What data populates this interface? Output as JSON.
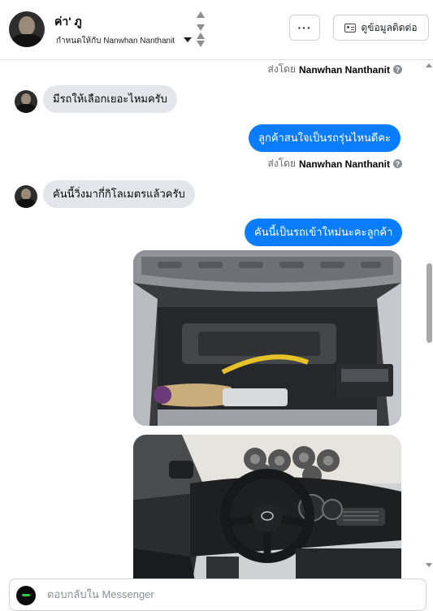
{
  "header": {
    "contact_name": "ค่า' ภู",
    "assigned_prefix": "กำหนดให้กับ",
    "assigned_name": "Nanwhan Nanthanit",
    "more_label": "···",
    "contact_info_label": "ดูข้อมูลติดต่อ"
  },
  "messages": [
    {
      "type": "sent_by",
      "prefix": "ส่งโดย",
      "name": "Nanwhan Nanthanit"
    },
    {
      "type": "incoming",
      "text": "มีรถให้เลือกเยอะไหมครับ"
    },
    {
      "type": "outgoing",
      "text": "ลูกค้าสนใจเป็นรถรุ่นไหนดีคะ"
    },
    {
      "type": "sent_by",
      "prefix": "ส่งโดย",
      "name": "Nanwhan Nanthanit"
    },
    {
      "type": "incoming",
      "text": "คันนี้วิ่งมากี่กิโลเมตรแล้วครับ"
    },
    {
      "type": "outgoing",
      "text": "คันนี้เป็นรถเข้าใหม่นะคะลูกค้า"
    },
    {
      "type": "photo",
      "subject": "engine-bay"
    },
    {
      "type": "photo",
      "subject": "interior-dashboard"
    }
  ],
  "composer": {
    "placeholder": "ตอบกลับใน Messenger"
  },
  "colors": {
    "outgoing_bubble": "#0a7cff",
    "incoming_bubble": "#e4e6eb"
  }
}
